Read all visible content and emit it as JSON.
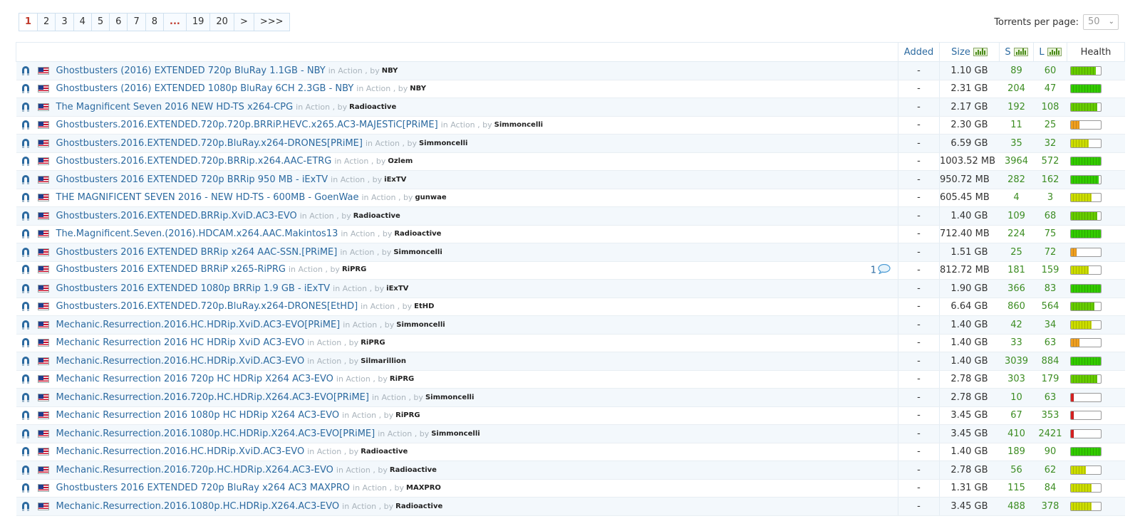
{
  "pagination": {
    "pages": [
      "1",
      "2",
      "3",
      "4",
      "5",
      "6",
      "7",
      "8",
      "...",
      "19",
      "20",
      ">",
      ">>>"
    ],
    "current": "1"
  },
  "per_page": {
    "label": "Torrents per page:",
    "value": "50"
  },
  "columns": {
    "added": "Added",
    "size": "Size",
    "seeders": "S",
    "leechers": "L",
    "health": "Health"
  },
  "colors": {
    "link": "#2c6aa0",
    "seed": "#3d8d23",
    "current_page": "#c0392b"
  },
  "icons": {
    "magnet": "magnet-icon",
    "flag": "us-flag-icon",
    "comment": "comment-bubble-icon",
    "sort": "chart-sort-icon"
  },
  "in_label": "in Action",
  "by_label": ", by",
  "rows": [
    {
      "name": "Ghostbusters (2016) EXTENDED 720p BluRay 1.1GB - NBY",
      "uploader": "NBY",
      "added": "-",
      "size": "1.10 GB",
      "seeders": "89",
      "leechers": "60",
      "health": 0.85,
      "health_class": "good"
    },
    {
      "name": "Ghostbusters (2016) EXTENDED 1080p BluRay 6CH 2.3GB - NBY",
      "uploader": "NBY",
      "added": "-",
      "size": "2.31 GB",
      "seeders": "204",
      "leechers": "47",
      "health": 1.0,
      "health_class": "high"
    },
    {
      "name": "The Magnificent Seven 2016 NEW HD-TS x264-CPG",
      "uploader": "Radioactive",
      "added": "-",
      "size": "2.17 GB",
      "seeders": "192",
      "leechers": "108",
      "health": 0.9,
      "health_class": "good"
    },
    {
      "name": "Ghostbusters.2016.EXTENDED.720p.720p.BRRiP.HEVC.x265.AC3-MAJESTiC[PRiME]",
      "uploader": "Simmoncelli",
      "added": "-",
      "size": "2.30 GB",
      "seeders": "11",
      "leechers": "25",
      "health": 0.3,
      "health_class": "low"
    },
    {
      "name": "Ghostbusters.2016.EXTENDED.720p.BluRay.x264-DRONES[PRiME]",
      "uploader": "Simmoncelli",
      "added": "-",
      "size": "6.59 GB",
      "seeders": "35",
      "leechers": "32",
      "health": 0.6,
      "health_class": "mid"
    },
    {
      "name": "Ghostbusters.2016.EXTENDED.720p.BRRip.x264.AAC-ETRG",
      "uploader": "Ozlem",
      "added": "-",
      "size": "1003.52 MB",
      "seeders": "3964",
      "leechers": "572",
      "health": 1.0,
      "health_class": "high"
    },
    {
      "name": "Ghostbusters 2016 EXTENDED 720p BRRip 950 MB - iExTV",
      "uploader": "iExTV",
      "added": "-",
      "size": "950.72 MB",
      "seeders": "282",
      "leechers": "162",
      "health": 0.95,
      "health_class": "high"
    },
    {
      "name": "THE MAGNIFICENT SEVEN 2016 - NEW HD-TS - 600MB - GoenWae",
      "uploader": "gunwae",
      "added": "-",
      "size": "605.45 MB",
      "seeders": "4",
      "leechers": "3",
      "health": 0.7,
      "health_class": "mid"
    },
    {
      "name": "Ghostbusters.2016.EXTENDED.BRRip.XviD.AC3-EVO",
      "uploader": "Radioactive",
      "added": "-",
      "size": "1.40 GB",
      "seeders": "109",
      "leechers": "68",
      "health": 0.9,
      "health_class": "good"
    },
    {
      "name": "The.Magnificent.Seven.(2016).HDCAM.x264.AAC.Makintos13",
      "uploader": "Radioactive",
      "added": "-",
      "size": "712.40 MB",
      "seeders": "224",
      "leechers": "75",
      "health": 1.0,
      "health_class": "high"
    },
    {
      "name": "Ghostbusters 2016 EXTENDED BRRip x264 AAC-SSN.[PRiME]",
      "uploader": "Simmoncelli",
      "added": "-",
      "size": "1.51 GB",
      "seeders": "25",
      "leechers": "72",
      "health": 0.2,
      "health_class": "low"
    },
    {
      "name": "Ghostbusters 2016 EXTENDED BRRiP x265-RiPRG",
      "uploader": "RiPRG",
      "comments": "1",
      "added": "-",
      "size": "812.72 MB",
      "seeders": "181",
      "leechers": "159",
      "health": 0.6,
      "health_class": "mid"
    },
    {
      "name": "Ghostbusters 2016 EXTENDED 1080p BRRip 1.9 GB - iExTV",
      "uploader": "iExTV",
      "added": "-",
      "size": "1.90 GB",
      "seeders": "366",
      "leechers": "83",
      "health": 1.0,
      "health_class": "high"
    },
    {
      "name": "Ghostbusters.2016.EXTENDED.720p.BluRay.x264-DRONES[EtHD]",
      "uploader": "EtHD",
      "added": "-",
      "size": "6.64 GB",
      "seeders": "860",
      "leechers": "564",
      "health": 0.8,
      "health_class": "good"
    },
    {
      "name": "Mechanic.Resurrection.2016.HC.HDRip.XviD.AC3-EVO[PRiME]",
      "uploader": "Simmoncelli",
      "added": "-",
      "size": "1.40 GB",
      "seeders": "42",
      "leechers": "34",
      "health": 0.7,
      "health_class": "mid"
    },
    {
      "name": "Mechanic Resurrection 2016 HC HDRip XviD AC3-EVO",
      "uploader": "RiPRG",
      "added": "-",
      "size": "1.40 GB",
      "seeders": "33",
      "leechers": "63",
      "health": 0.3,
      "health_class": "low"
    },
    {
      "name": "Mechanic.Resurrection.2016.HC.HDRip.XviD.AC3-EVO",
      "uploader": "Silmarillion",
      "added": "-",
      "size": "1.40 GB",
      "seeders": "3039",
      "leechers": "884",
      "health": 1.0,
      "health_class": "high"
    },
    {
      "name": "Mechanic Resurrection 2016 720p HC HDRip X264 AC3-EVO",
      "uploader": "RiPRG",
      "added": "-",
      "size": "2.78 GB",
      "seeders": "303",
      "leechers": "179",
      "health": 0.9,
      "health_class": "good"
    },
    {
      "name": "Mechanic.Resurrection.2016.720p.HC.HDRip.X264.AC3-EVO[PRiME]",
      "uploader": "Simmoncelli",
      "added": "-",
      "size": "2.78 GB",
      "seeders": "10",
      "leechers": "63",
      "health": 0.1,
      "health_class": "bad"
    },
    {
      "name": "Mechanic Resurrection 2016 1080p HC HDRip X264 AC3-EVO",
      "uploader": "RiPRG",
      "added": "-",
      "size": "3.45 GB",
      "seeders": "67",
      "leechers": "353",
      "health": 0.1,
      "health_class": "bad"
    },
    {
      "name": "Mechanic.Resurrection.2016.1080p.HC.HDRip.X264.AC3-EVO[PRiME]",
      "uploader": "Simmoncelli",
      "added": "-",
      "size": "3.45 GB",
      "seeders": "410",
      "leechers": "2421",
      "health": 0.1,
      "health_class": "bad"
    },
    {
      "name": "Mechanic.Resurrection.2016.HC.HDRip.XviD.AC3-EVO",
      "uploader": "Radioactive",
      "added": "-",
      "size": "1.40 GB",
      "seeders": "189",
      "leechers": "90",
      "health": 1.0,
      "health_class": "high"
    },
    {
      "name": "Mechanic.Resurrection.2016.720p.HC.HDRip.X264.AC3-EVO",
      "uploader": "Radioactive",
      "added": "-",
      "size": "2.78 GB",
      "seeders": "56",
      "leechers": "62",
      "health": 0.5,
      "health_class": "mid"
    },
    {
      "name": "Ghostbusters 2016 EXTENDED 720p BluRay x264 AC3 MAXPRO",
      "uploader": "MAXPRO",
      "added": "-",
      "size": "1.31 GB",
      "seeders": "115",
      "leechers": "84",
      "health": 0.7,
      "health_class": "mid"
    },
    {
      "name": "Mechanic.Resurrection.2016.1080p.HC.HDRip.X264.AC3-EVO",
      "uploader": "Radioactive",
      "added": "-",
      "size": "3.45 GB",
      "seeders": "488",
      "leechers": "378",
      "health": 0.7,
      "health_class": "mid"
    }
  ]
}
